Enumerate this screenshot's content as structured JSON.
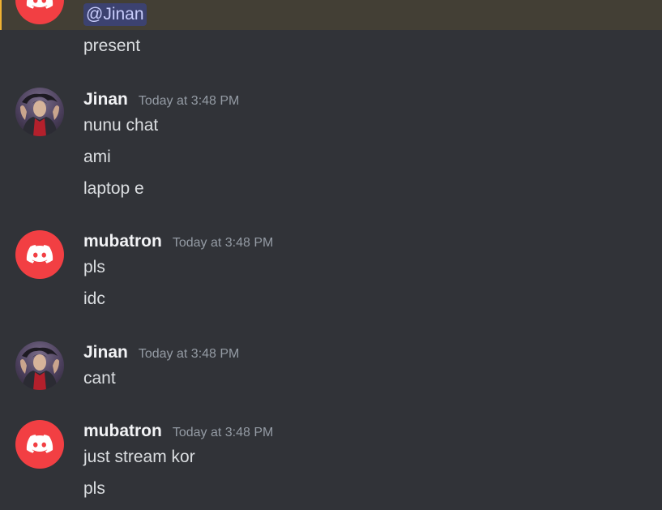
{
  "top_message": {
    "mention": "@Jinan",
    "lines": [
      "present"
    ]
  },
  "messages": [
    {
      "username": "Jinan",
      "timestamp": "Today at 3:48 PM",
      "avatar_icon": "user-photo-avatar",
      "lines": [
        "nunu chat",
        "ami",
        "laptop e"
      ]
    },
    {
      "username": "mubatron",
      "timestamp": "Today at 3:48 PM",
      "avatar_icon": "discord-logo-avatar",
      "lines": [
        "pls",
        "idc"
      ]
    },
    {
      "username": "Jinan",
      "timestamp": "Today at 3:48 PM",
      "avatar_icon": "user-photo-avatar",
      "lines": [
        "cant"
      ]
    },
    {
      "username": "mubatron",
      "timestamp": "Today at 3:48 PM",
      "avatar_icon": "discord-logo-avatar",
      "lines": [
        "just stream kor",
        "pls"
      ]
    }
  ],
  "colors": {
    "background": "#313338",
    "mention_highlight": "#433f35",
    "mention_bar": "#f0b232",
    "discord_red": "#f23f43",
    "username": "#f2f3f5",
    "timestamp": "#949ba4",
    "text": "#dbdee1"
  }
}
